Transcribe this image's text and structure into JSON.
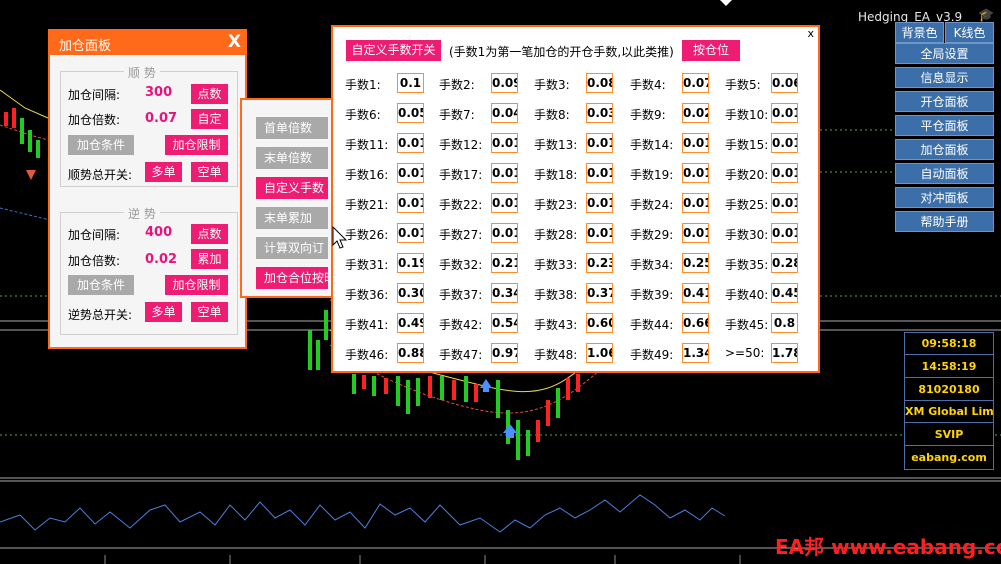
{
  "app": {
    "title": "Hedging_EA_v3.9"
  },
  "add_panel": {
    "title": "加仓面板",
    "close": "X",
    "trend": {
      "section": "顺 势",
      "interval_label": "加仓间隔:",
      "interval_value": "300",
      "interval_btn": "点数",
      "multiple_label": "加仓倍数:",
      "multiple_value": "0.07",
      "multiple_btn": "自定",
      "cond_btn": "加仓条件",
      "limit_btn": "加仓限制",
      "switch_label": "顺势总开关:",
      "buy_btn": "多单",
      "sell_btn": "空单"
    },
    "counter": {
      "section": "逆 势",
      "interval_label": "加仓间隔:",
      "interval_value": "400",
      "interval_btn": "点数",
      "multiple_label": "加仓倍数:",
      "multiple_value": "0.02",
      "multiple_btn": "累加",
      "cond_btn": "加仓条件",
      "limit_btn": "加仓限制",
      "switch_label": "逆势总开关:",
      "buy_btn": "多单",
      "sell_btn": "空单"
    }
  },
  "mode_panel": {
    "buttons": [
      {
        "label": "首单倍数",
        "active": false
      },
      {
        "label": "末单倍数",
        "active": false
      },
      {
        "label": "自定义手数",
        "active": true
      },
      {
        "label": "末单累加",
        "active": false
      },
      {
        "label": "计算双向订",
        "active": false
      },
      {
        "label": "加仓合位按时",
        "active": true
      }
    ]
  },
  "lots_panel": {
    "toggle_label": "自定义手数开关",
    "note": "(手数1为第一笔加仓的开仓手数,以此类推)",
    "pos_btn": "按仓位",
    "close": "x",
    "lots": [
      {
        "label": "手数1:",
        "value": "0.1"
      },
      {
        "label": "手数2:",
        "value": "0.09"
      },
      {
        "label": "手数3:",
        "value": "0.08"
      },
      {
        "label": "手数4:",
        "value": "0.07"
      },
      {
        "label": "手数5:",
        "value": "0.06"
      },
      {
        "label": "手数6:",
        "value": "0.05"
      },
      {
        "label": "手数7:",
        "value": "0.04"
      },
      {
        "label": "手数8:",
        "value": "0.03"
      },
      {
        "label": "手数9:",
        "value": "0.02"
      },
      {
        "label": "手数10:",
        "value": "0.01"
      },
      {
        "label": "手数11:",
        "value": "0.01"
      },
      {
        "label": "手数12:",
        "value": "0.01"
      },
      {
        "label": "手数13:",
        "value": "0.01"
      },
      {
        "label": "手数14:",
        "value": "0.01"
      },
      {
        "label": "手数15:",
        "value": "0.01"
      },
      {
        "label": "手数16:",
        "value": "0.01"
      },
      {
        "label": "手数17:",
        "value": "0.01"
      },
      {
        "label": "手数18:",
        "value": "0.01"
      },
      {
        "label": "手数19:",
        "value": "0.01"
      },
      {
        "label": "手数20:",
        "value": "0.01"
      },
      {
        "label": "手数21:",
        "value": "0.01"
      },
      {
        "label": "手数22:",
        "value": "0.01"
      },
      {
        "label": "手数23:",
        "value": "0.01"
      },
      {
        "label": "手数24:",
        "value": "0.01"
      },
      {
        "label": "手数25:",
        "value": "0.01"
      },
      {
        "label": "手数26:",
        "value": "0.01"
      },
      {
        "label": "手数27:",
        "value": "0.01"
      },
      {
        "label": "手数28:",
        "value": "0.01"
      },
      {
        "label": "手数29:",
        "value": "0.01"
      },
      {
        "label": "手数30:",
        "value": "0.01"
      },
      {
        "label": "手数31:",
        "value": "0.19"
      },
      {
        "label": "手数32:",
        "value": "0.21"
      },
      {
        "label": "手数33:",
        "value": "0.23"
      },
      {
        "label": "手数34:",
        "value": "0.25"
      },
      {
        "label": "手数35:",
        "value": "0.28"
      },
      {
        "label": "手数36:",
        "value": "0.30"
      },
      {
        "label": "手数37:",
        "value": "0.34"
      },
      {
        "label": "手数38:",
        "value": "0.37"
      },
      {
        "label": "手数39:",
        "value": "0.41"
      },
      {
        "label": "手数40:",
        "value": "0.45"
      },
      {
        "label": "手数41:",
        "value": "0.49"
      },
      {
        "label": "手数42:",
        "value": "0.54"
      },
      {
        "label": "手数43:",
        "value": "0.60"
      },
      {
        "label": "手数44:",
        "value": "0.66"
      },
      {
        "label": "手数45:",
        "value": "0.8"
      },
      {
        "label": "手数46:",
        "value": "0.88"
      },
      {
        "label": "手数47:",
        "value": "0.97"
      },
      {
        "label": "手数48:",
        "value": "1.06"
      },
      {
        "label": "手数49:",
        "value": "1.34"
      },
      {
        "label": ">=50:",
        "value": "1.78"
      }
    ]
  },
  "right_menu": {
    "top": [
      "背景色",
      "K线色"
    ],
    "items": [
      "全局设置",
      "信息显示",
      "开仓面板",
      "平仓面板",
      "加仓面板",
      "自动面板",
      "对冲面板",
      "帮助手册"
    ]
  },
  "info": [
    "09:58:18",
    "14:58:19",
    "81020180",
    "XM Global Limited",
    "SVIP",
    "eabang.com"
  ],
  "watermark": "EA邦 www.eabang.com",
  "colors": {
    "accent": "#ff6a1a",
    "pink": "#ef1c74",
    "blue": "#3c6fa9",
    "info_text": "#ffd400"
  }
}
